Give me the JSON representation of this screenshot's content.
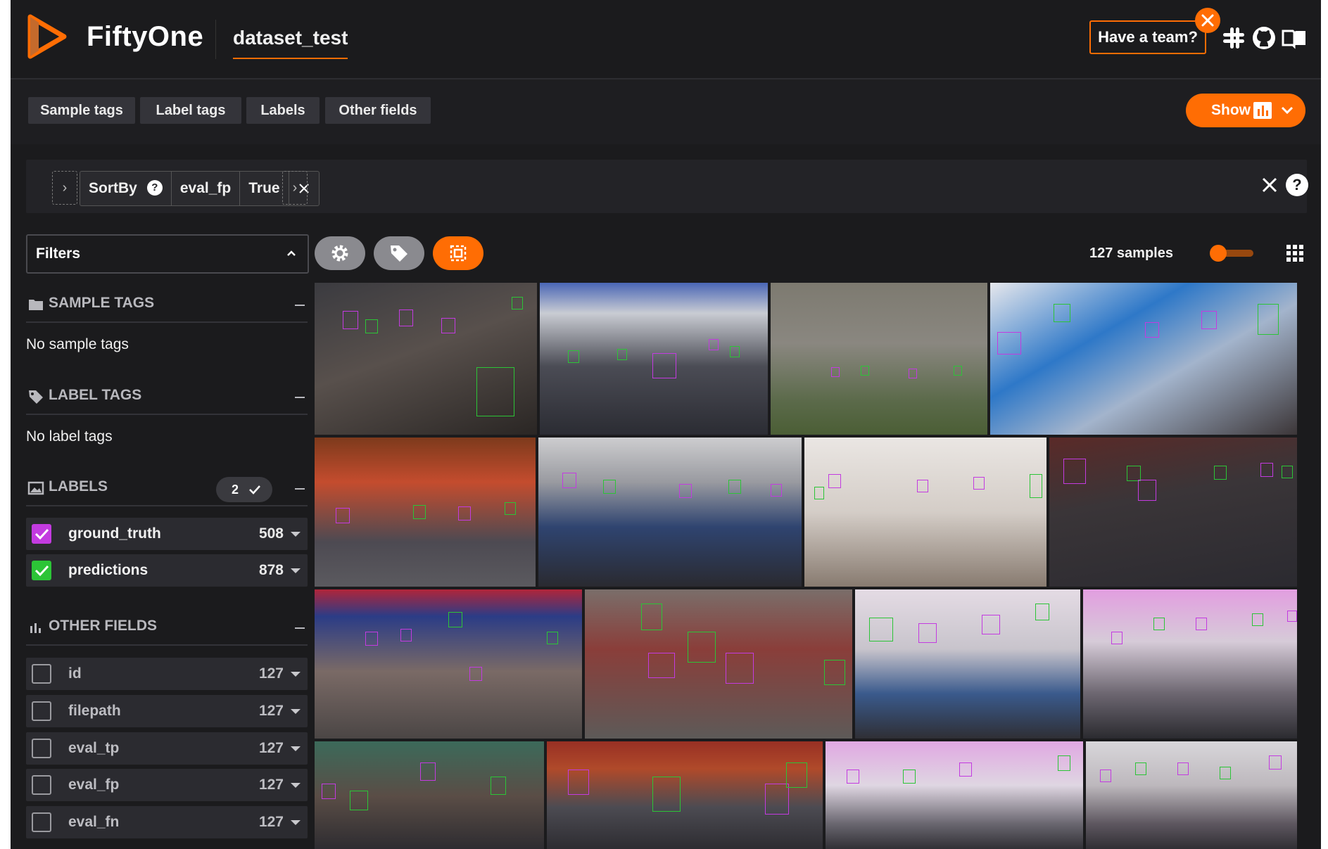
{
  "app": {
    "name": "FiftyOne",
    "dataset": "dataset_test",
    "team_button": "Have a team?",
    "header_icons": [
      "slack-icon",
      "github-icon",
      "docs-book-icon"
    ]
  },
  "tabs": [
    "Sample tags",
    "Label tags",
    "Labels",
    "Other fields"
  ],
  "show_button": {
    "label": "Show",
    "icon": "bar-chart-icon"
  },
  "view_bar": {
    "stage_name": "SortBy",
    "stage_field": "eval_fp",
    "stage_value": "True"
  },
  "sidebar": {
    "filters_select": "Filters",
    "sample_tags": {
      "title": "SAMPLE TAGS",
      "empty": "No sample tags"
    },
    "label_tags": {
      "title": "LABEL TAGS",
      "empty": "No label tags"
    },
    "labels": {
      "title": "LABELS",
      "badge": "2",
      "fields": [
        {
          "name": "ground_truth",
          "count": "508",
          "checked": true,
          "color": "#c33be0"
        },
        {
          "name": "predictions",
          "count": "878",
          "checked": true,
          "color": "#2cc437"
        }
      ]
    },
    "other_fields": {
      "title": "OTHER FIELDS",
      "fields": [
        {
          "name": "id",
          "count": "127"
        },
        {
          "name": "filepath",
          "count": "127"
        },
        {
          "name": "eval_tp",
          "count": "127"
        },
        {
          "name": "eval_fp",
          "count": "127"
        },
        {
          "name": "eval_fn",
          "count": "127"
        }
      ]
    }
  },
  "grid": {
    "samples_count": "127 samples",
    "tools": [
      "settings-gear-icon",
      "tag-icon",
      "patches-icon"
    ]
  },
  "colors": {
    "accent": "#ff6d04",
    "background": "#1b1b1d",
    "ground_truth": "#c33be0",
    "predictions": "#2cc437"
  }
}
